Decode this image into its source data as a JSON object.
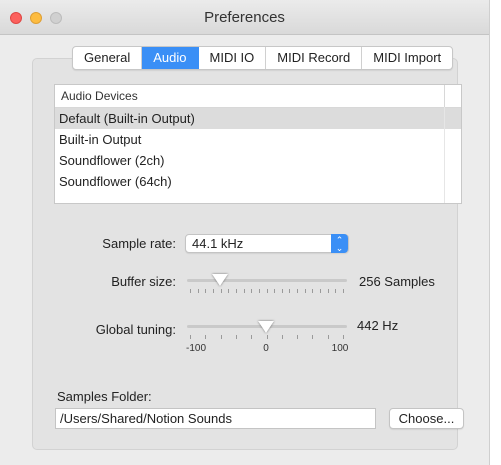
{
  "window": {
    "title": "Preferences"
  },
  "tabs": [
    {
      "label": "General",
      "active": false
    },
    {
      "label": "Audio",
      "active": true
    },
    {
      "label": "MIDI IO",
      "active": false
    },
    {
      "label": "MIDI Record",
      "active": false
    },
    {
      "label": "MIDI Import",
      "active": false
    }
  ],
  "audio_devices": {
    "header": "Audio Devices",
    "rows": [
      "Default (Built-in Output)",
      "Built-in Output",
      "Soundflower (2ch)",
      "Soundflower (64ch)"
    ],
    "selected_index": 0
  },
  "sample_rate": {
    "label": "Sample rate:",
    "value": "44.1 kHz"
  },
  "buffer_size": {
    "label": "Buffer size:",
    "value_text": "256 Samples"
  },
  "global_tuning": {
    "label": "Global tuning:",
    "value_text": "442 Hz",
    "min_label": "-100",
    "mid_label": "0",
    "max_label": "100"
  },
  "samples_folder": {
    "label": "Samples Folder:",
    "path": "/Users/Shared/Notion Sounds",
    "choose_label": "Choose..."
  },
  "colors": {
    "accent": "#3a8ff6",
    "selected_row": "#dcdcdc"
  },
  "icons": {
    "close": "close-icon",
    "minimize": "minimize-icon",
    "zoom": "zoom-icon",
    "select_arrows": "up-down-chevron-icon"
  }
}
